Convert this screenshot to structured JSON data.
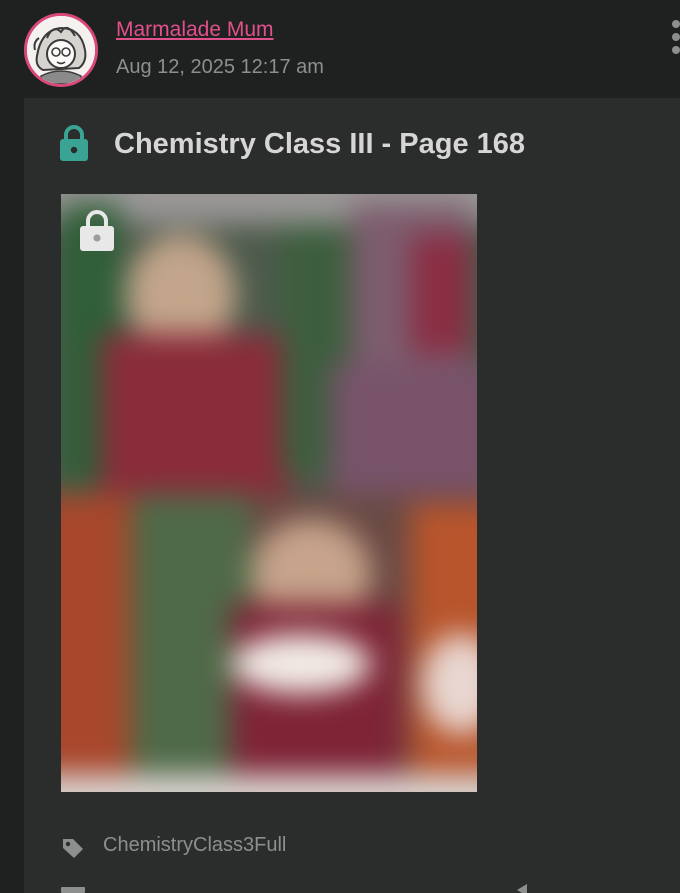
{
  "author": {
    "name": "Marmalade Mum",
    "date": "Aug 12, 2025 12:17 am"
  },
  "post": {
    "title": "Chemistry Class III - Page 168",
    "locked": true,
    "tags": [
      "ChemistryClass3Full"
    ]
  },
  "icons": {
    "title_lock": "lock-icon",
    "thumb_lock": "lock-icon",
    "tag": "tag-icon",
    "menu": "more-vertical-icon"
  },
  "colors": {
    "accent": "#e2508c",
    "lock": "#3aa394",
    "background": "#1f2020",
    "card": "#2b2c2c",
    "text_muted": "#8d8f8f",
    "title": "#d6d6d6"
  }
}
